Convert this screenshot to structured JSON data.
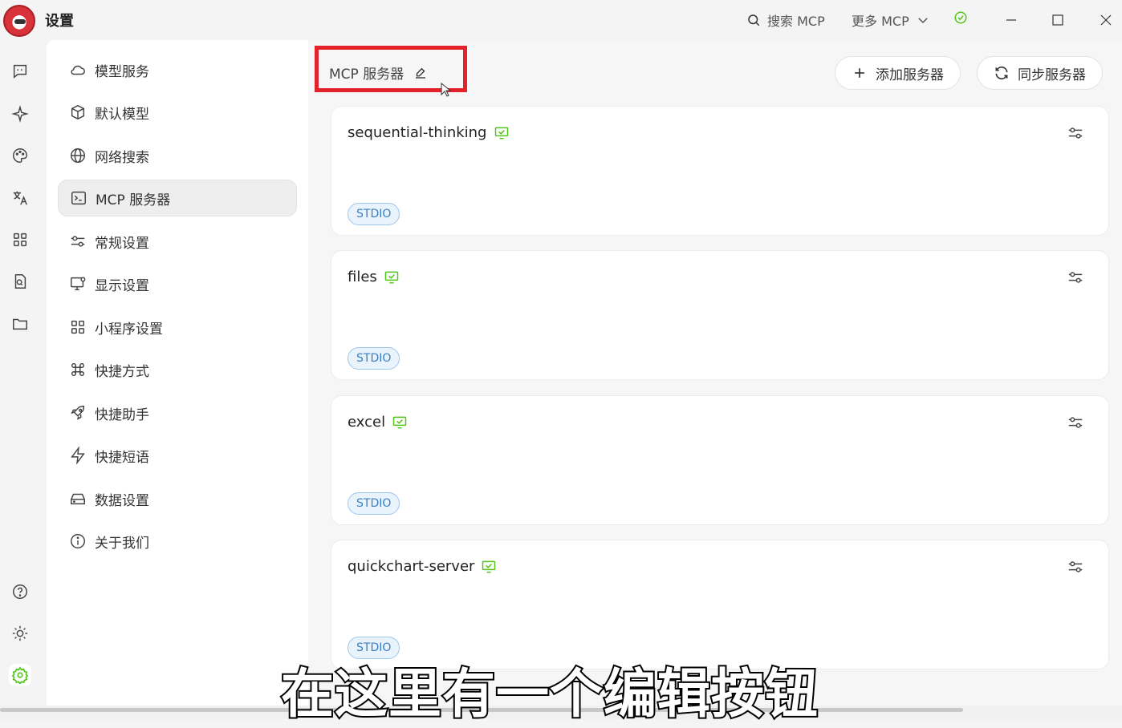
{
  "window": {
    "title": "设置",
    "search_mcp": "搜索 MCP",
    "more_mcp": "更多 MCP"
  },
  "menu": {
    "items": [
      {
        "label": "模型服务",
        "icon": "cloud-icon"
      },
      {
        "label": "默认模型",
        "icon": "cube-icon"
      },
      {
        "label": "网络搜索",
        "icon": "globe-icon"
      },
      {
        "label": "MCP 服务器",
        "icon": "terminal-icon"
      },
      {
        "label": "常规设置",
        "icon": "sliders-icon"
      },
      {
        "label": "显示设置",
        "icon": "monitor-icon"
      },
      {
        "label": "小程序设置",
        "icon": "grid-icon"
      },
      {
        "label": "快捷方式",
        "icon": "command-icon"
      },
      {
        "label": "快捷助手",
        "icon": "rocket-icon"
      },
      {
        "label": "快捷短语",
        "icon": "zap-icon"
      },
      {
        "label": "数据设置",
        "icon": "hard-drive-icon"
      },
      {
        "label": "关于我们",
        "icon": "info-icon"
      }
    ],
    "active_index": 3
  },
  "main": {
    "title": "MCP 服务器",
    "add_server": "添加服务器",
    "sync_server": "同步服务器",
    "servers": [
      {
        "name": "sequential-thinking",
        "type": "STDIO"
      },
      {
        "name": "files",
        "type": "STDIO"
      },
      {
        "name": "excel",
        "type": "STDIO"
      },
      {
        "name": "quickchart-server",
        "type": "STDIO"
      }
    ]
  },
  "subtitle": "在这里有一个编辑按钮",
  "colors": {
    "accent_green": "#52c41a",
    "highlight_red": "#e2232c",
    "badge_blue": "#3a7fc4"
  }
}
